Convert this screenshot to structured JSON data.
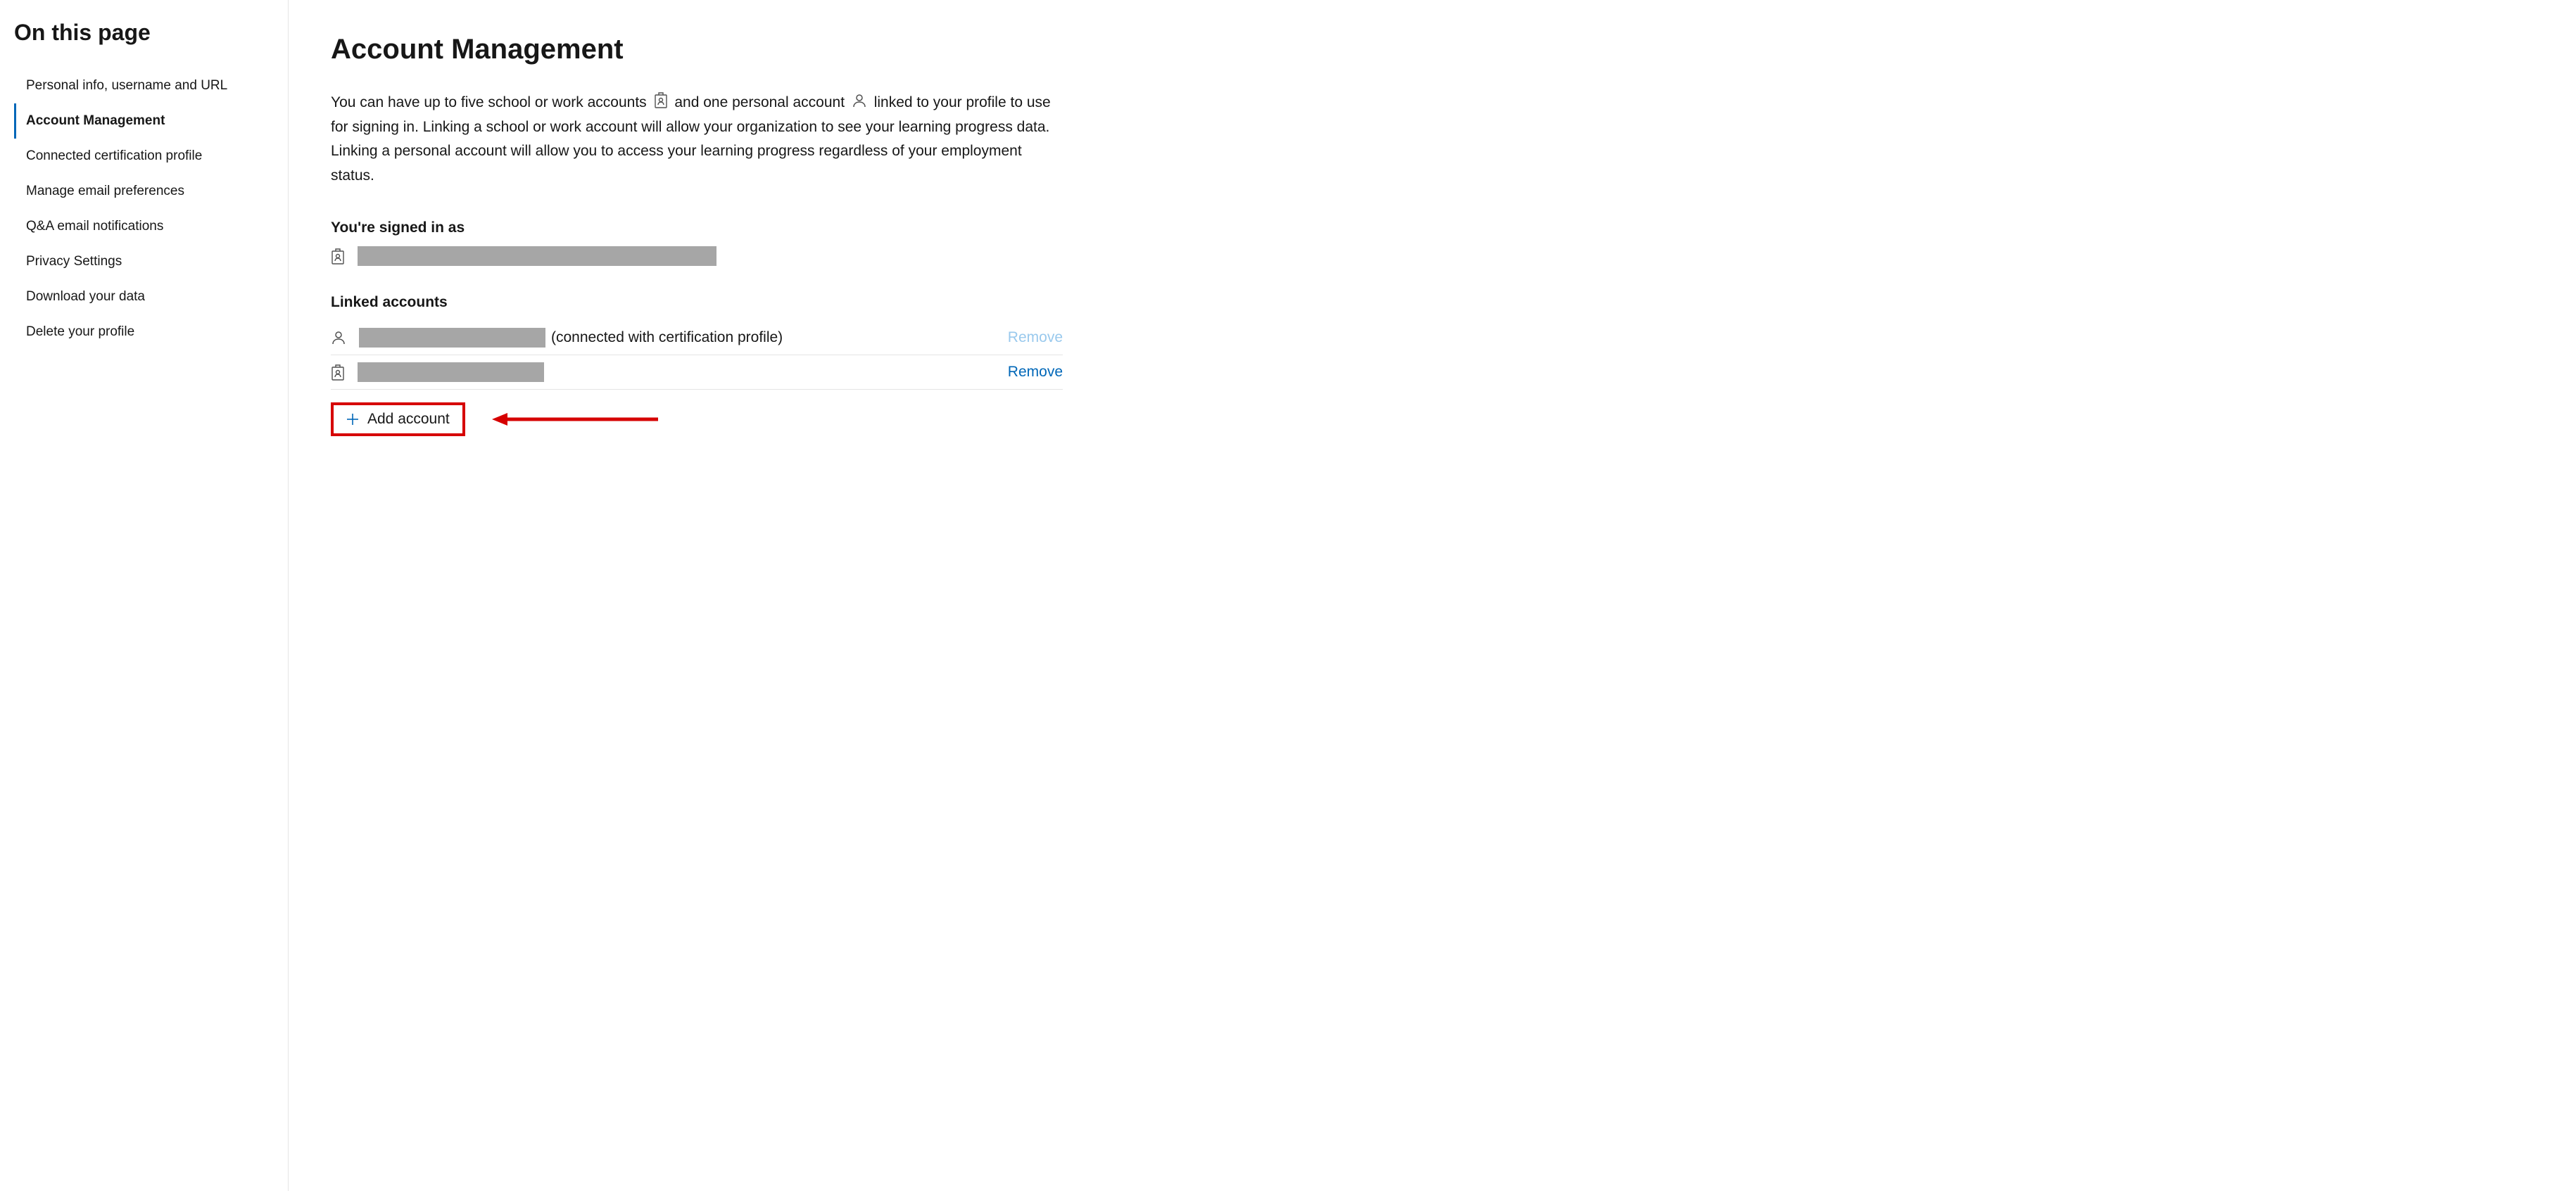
{
  "sidebar": {
    "title": "On this page",
    "items": [
      {
        "label": "Personal info, username and URL",
        "active": false
      },
      {
        "label": "Account Management",
        "active": true
      },
      {
        "label": "Connected certification profile",
        "active": false
      },
      {
        "label": "Manage email preferences",
        "active": false
      },
      {
        "label": "Q&A email notifications",
        "active": false
      },
      {
        "label": "Privacy Settings",
        "active": false
      },
      {
        "label": "Download your data",
        "active": false
      },
      {
        "label": "Delete your profile",
        "active": false
      }
    ]
  },
  "main": {
    "heading": "Account Management",
    "desc_part1": "You can have up to five school or work accounts ",
    "desc_part2": " and one personal account ",
    "desc_part3": " linked to your profile to use for signing in. Linking a school or work account will allow your organization to see your learning progress data. Linking a personal account will allow you to access your learning progress regardless of your employment status.",
    "signed_in_label": "You're signed in as",
    "linked_label": "Linked accounts",
    "linked": [
      {
        "note": "(connected with certification profile)",
        "remove_text": "Remove",
        "remove_enabled": false,
        "icon": "person"
      },
      {
        "note": "",
        "remove_text": "Remove",
        "remove_enabled": true,
        "icon": "badge"
      }
    ],
    "add_account_label": "Add account"
  },
  "colors": {
    "accent": "#0067b8",
    "annotation_red": "#d60000",
    "redacted_gray": "#a6a6a6"
  }
}
